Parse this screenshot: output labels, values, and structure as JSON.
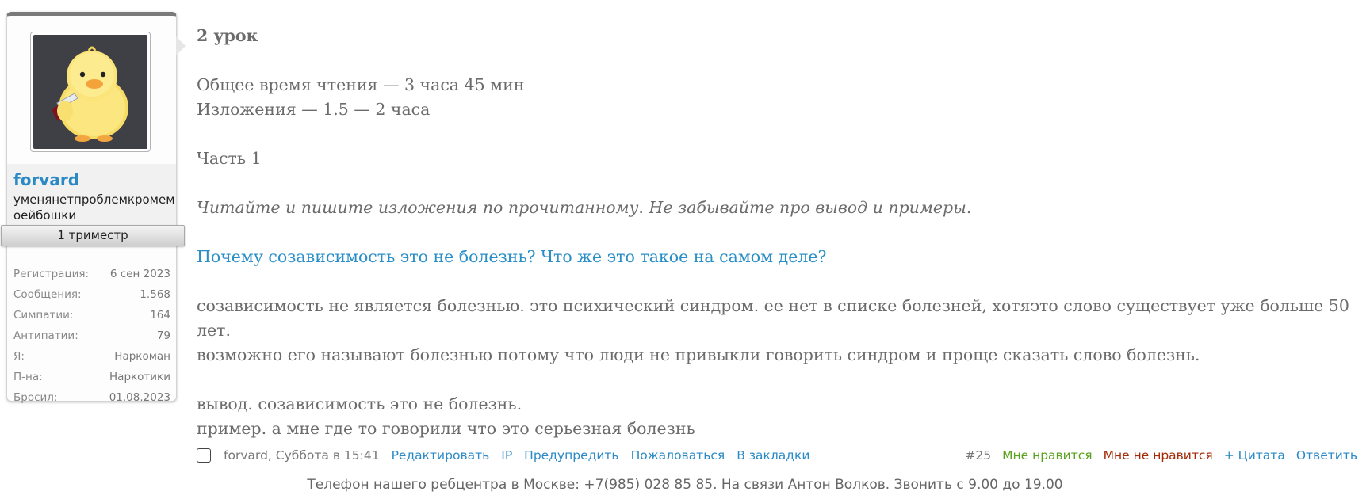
{
  "user": {
    "avatar_icon": "yellow-chick-with-knife",
    "username": "forvard",
    "title": "уменянетпроблемкромемоейбошки",
    "rank": "1 триместр",
    "stats": [
      {
        "key": "Регистрация:",
        "value": "6 сен 2023"
      },
      {
        "key": "Сообщения:",
        "value": "1.568"
      },
      {
        "key": "Симпатии:",
        "value": "164"
      },
      {
        "key": "Антипатии:",
        "value": "79"
      },
      {
        "key": "Я:",
        "value": "Наркоман"
      },
      {
        "key": "П-на:",
        "value": "Наркотики"
      },
      {
        "key": "Бросил:",
        "value": "01.08.2023"
      }
    ]
  },
  "message": {
    "heading": "2 урок",
    "reading_time": "Общее время чтения — 3 часа 45 мин",
    "summary_time": "Изложения — 1.5 — 2 часа",
    "part": "Часть 1",
    "instruction": "Читайте и пишите изложения по прочитанному. Не забывайте про вывод и примеры.",
    "question": "Почему созависимость это не болезнь? Что же это такое на самом деле?",
    "answer_line1": "созависимость не является болезнью. это психический синдром. ее нет в списке болезней, хотяэто слово существует уже больше 50 лет.",
    "answer_line2": "возможно его называют болезнью потому что люди не привыкли говорить синдром и проще сказать слово болезнь.",
    "conclusion": "вывод. созависимость это не болезнь.",
    "example": "пример. а мне где то говорили что это серьезная болезнь"
  },
  "footer": {
    "meta": "forvard, Суббота в 15:41",
    "edit": "Редактировать",
    "ip": "IP",
    "warn": "Предупредить",
    "report": "Пожаловаться",
    "bookmark": "В закладки",
    "post_number": "#25",
    "like": "Мне нравится",
    "dislike": "Мне не нравится",
    "quote": "+ Цитата",
    "reply": "Ответить"
  },
  "notice": "Телефон нашего ребцентра в Москве: +7(985) 028 85 85. На связи Антон Волков. Звонить с 9.00 до 19.00"
}
